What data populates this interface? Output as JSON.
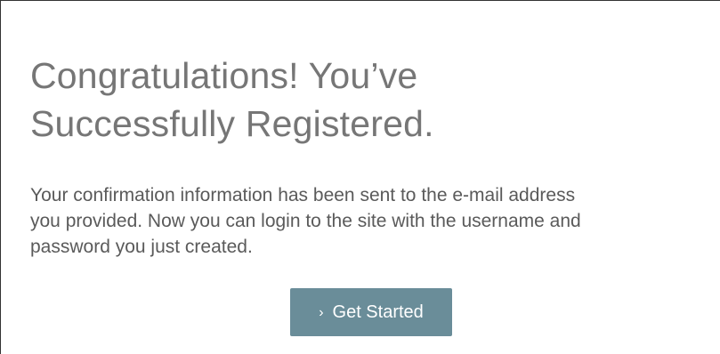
{
  "heading": {
    "line1": "Congratulations! You’ve",
    "line2": "Successfully Registered."
  },
  "message": {
    "line1": "Your confirmation information has been sent to the e-mail address",
    "line2": "you provided. Now you can login to the site with the username and",
    "line3": "password you just created."
  },
  "cta": {
    "icon": "chevron-right-icon",
    "icon_glyph": "›",
    "label": "Get Started",
    "background": "#6a8d99"
  }
}
